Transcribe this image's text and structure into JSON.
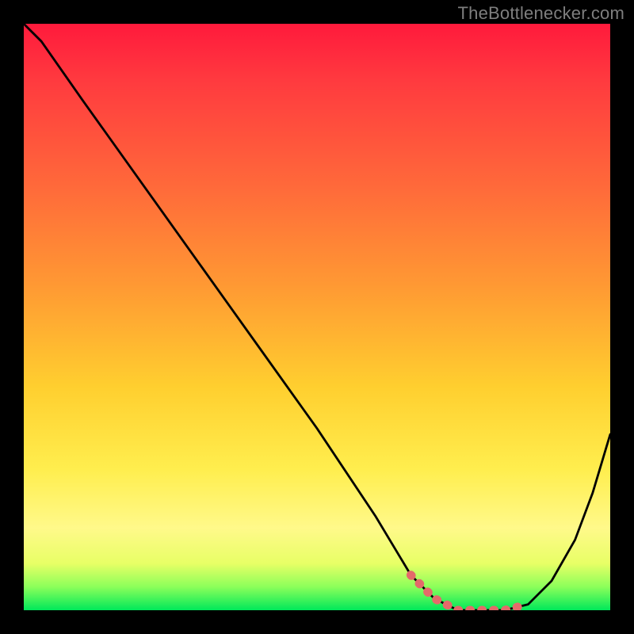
{
  "attribution": "TheBottlenecker.com",
  "colors": {
    "page_bg": "#000000",
    "attribution_text": "#7e7e7e",
    "curve_stroke": "#000000",
    "highlight_stroke": "#e46a6a"
  },
  "chart_data": {
    "type": "line",
    "title": "",
    "xlabel": "",
    "ylabel": "",
    "xlim": [
      0,
      100
    ],
    "ylim": [
      0,
      100
    ],
    "grid": false,
    "legend": false,
    "series": [
      {
        "name": "bottleneck-curve",
        "x": [
          0,
          3,
          10,
          20,
          30,
          40,
          50,
          60,
          66,
          70,
          74,
          78,
          82,
          86,
          90,
          94,
          97,
          100
        ],
        "values": [
          100,
          97,
          87,
          73,
          59,
          45,
          31,
          16,
          6,
          2,
          0,
          0,
          0,
          1,
          5,
          12,
          20,
          30
        ]
      }
    ],
    "highlight_range": {
      "x_start": 64,
      "x_end": 86
    },
    "gradient_stops": [
      {
        "pos": 0.0,
        "color": "#ff1a3c"
      },
      {
        "pos": 0.1,
        "color": "#ff3b3f"
      },
      {
        "pos": 0.28,
        "color": "#ff6a3a"
      },
      {
        "pos": 0.45,
        "color": "#ff9a33"
      },
      {
        "pos": 0.62,
        "color": "#ffcf2f"
      },
      {
        "pos": 0.76,
        "color": "#ffee4e"
      },
      {
        "pos": 0.86,
        "color": "#fff98a"
      },
      {
        "pos": 0.92,
        "color": "#e8ff66"
      },
      {
        "pos": 0.96,
        "color": "#8cff5a"
      },
      {
        "pos": 1.0,
        "color": "#00e85a"
      }
    ]
  }
}
